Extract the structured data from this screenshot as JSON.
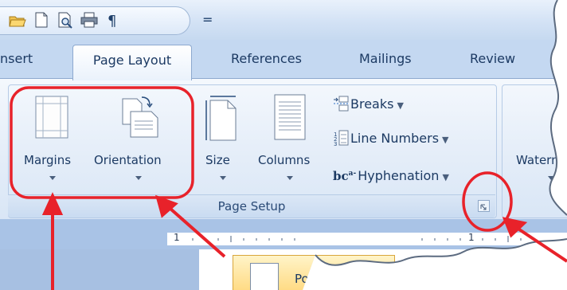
{
  "quick_access": {
    "icons": [
      "open-folder-icon",
      "new-document-icon",
      "print-preview-icon",
      "print-icon",
      "paragraph-marks-icon"
    ],
    "customize_glyph": "="
  },
  "tabs": [
    {
      "label": "nsert"
    },
    {
      "label": "Page Layout",
      "active": true
    },
    {
      "label": "References"
    },
    {
      "label": "Mailings"
    },
    {
      "label": "Review"
    }
  ],
  "page_setup": {
    "group_label": "Page Setup",
    "margins": {
      "label": "Margins"
    },
    "orientation": {
      "label": "Orientation"
    },
    "size": {
      "label": "Size"
    },
    "columns": {
      "label": "Columns"
    },
    "breaks": {
      "label": "Breaks"
    },
    "line_numbers": {
      "label": "Line Numbers"
    },
    "hyphenation": {
      "label": "Hyphenation",
      "icon_text": "bc"
    }
  },
  "next_group": {
    "watermark_label": "Waterm"
  },
  "ruler": {
    "numbers": [
      "1",
      "1"
    ]
  },
  "orientation_menu": {
    "portrait_label": "Portrait"
  },
  "colors": {
    "annotation_red": "#e8222a",
    "ribbon_blue": "#c4d8f1",
    "tab_text": "#1c3a63"
  }
}
